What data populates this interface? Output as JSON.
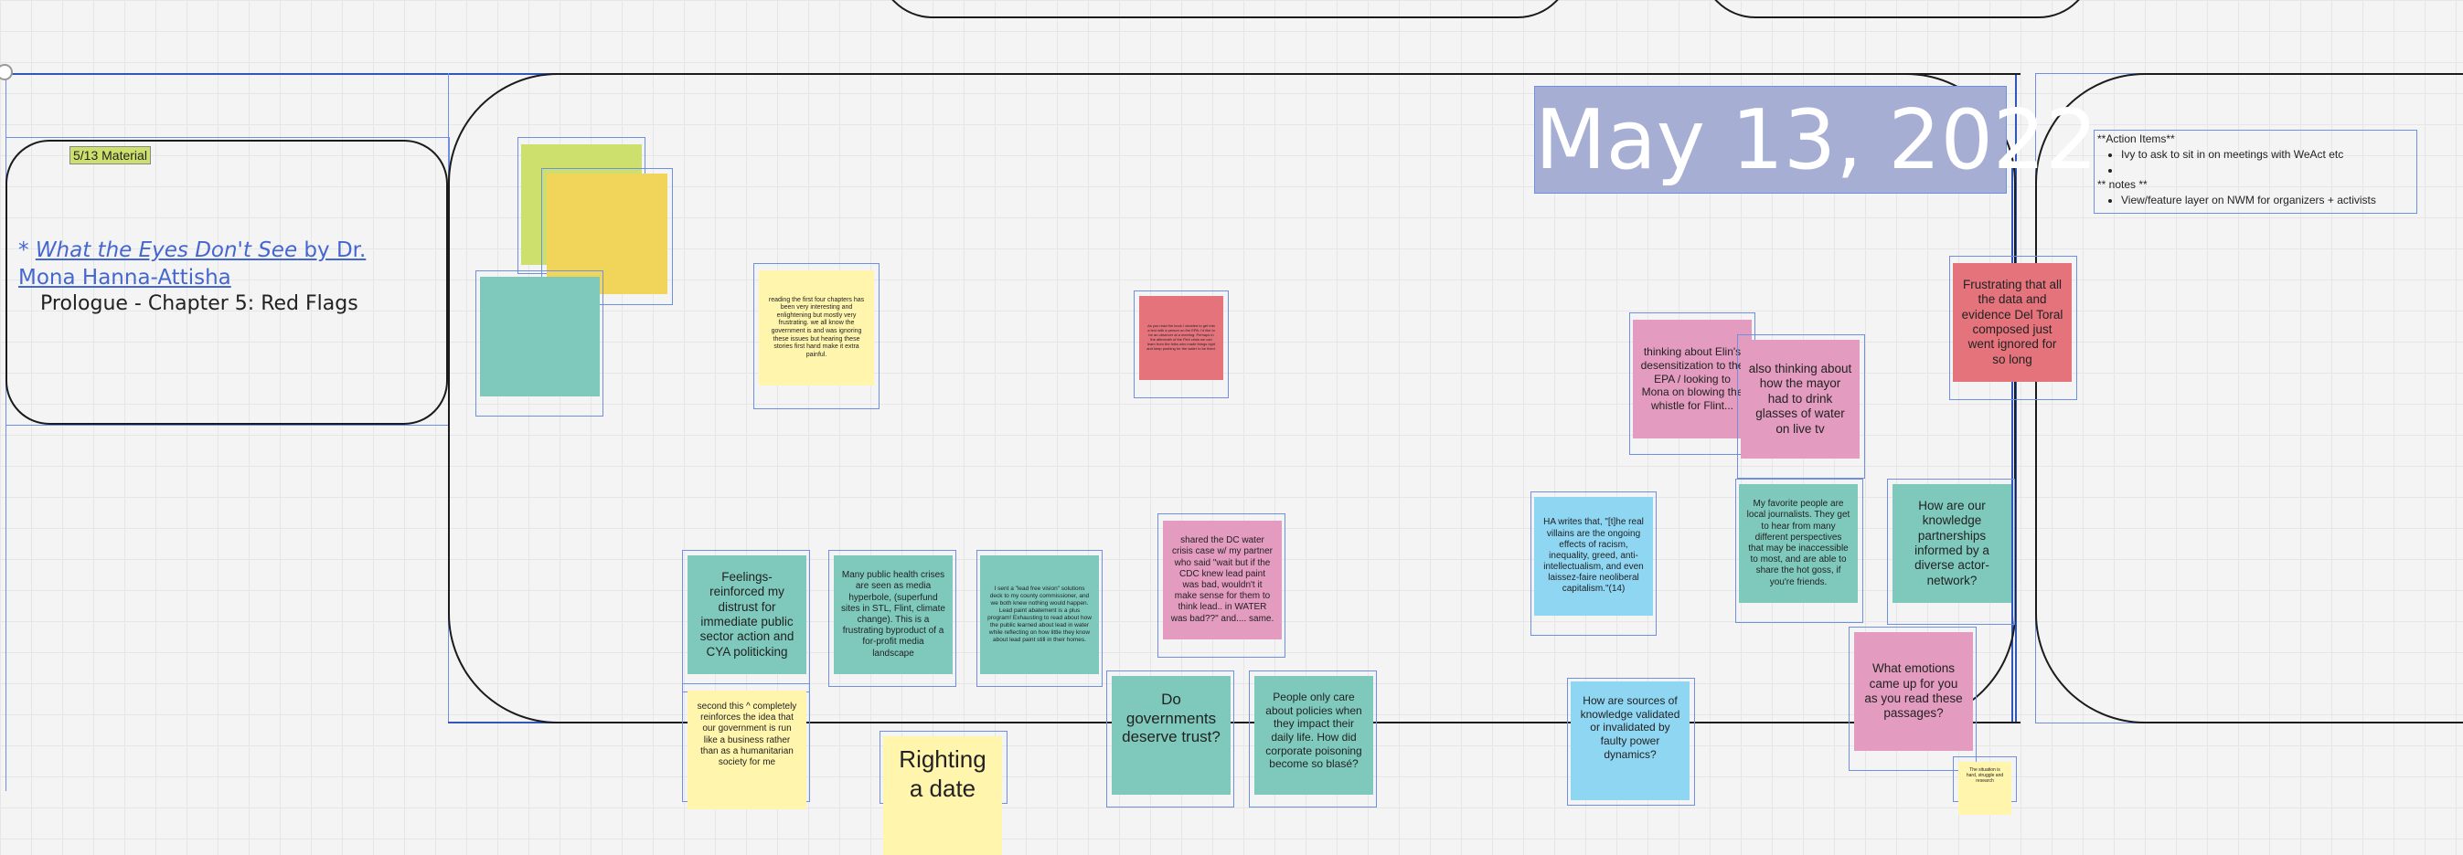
{
  "board": {
    "date_title": "May 13, 2022",
    "material_tag": "5/13 Material",
    "book": {
      "prefix": "* ",
      "title": "What the Eyes Don't See",
      "author": " by Dr. Mona Hanna-Attisha",
      "chapters": "Prologue - Chapter 5: Red Flags"
    },
    "notes": {
      "action_header": "**Action Items**",
      "action_items": [
        "Ivy to ask to sit in on meetings with WeAct etc",
        ""
      ],
      "notes_header": "** notes **",
      "note_items": [
        "View/feature layer on NWM for organizers + activists"
      ]
    }
  },
  "stickies": {
    "reading": "reading the first four chapters has been very interesting and enlightening but mostly very frustrating. we all know the government is and was ignoring these issues but hearing these stories first hand make it extra painful.",
    "red_small": "As you read the book I decided to get into a text with a person on the EPA; I'd like to be an observer at a meeting. Perhaps in the aftermath of the Flint crisis we can learn from the folks who made things right and keep pushing for the water to be fixed.",
    "elin": "thinking about Elin's desensitization to the EPA / looking to Mona on blowing the whistle for Flint...",
    "mayor": "also thinking about how the mayor had to drink glasses of water on live tv",
    "del_toral": "Frustrating that all the data and evidence Del Toral composed just went ignored for so long",
    "feelings": "Feelings-reinforced my distrust for immediate public sector action and CYA politicking",
    "public_health": "Many public health crises are seen as media hyperbole, (superfund sites in STL, Flint, climate change). This is a frustrating byproduct of a for-profit media landscape",
    "lead_free": "I sent a \"lead free vision\" solutions deck to my county commissioner, and we both knew nothing would happen. Lead paint abatement is a plus program! Exhausting to read about how the public learned about lead in water while reflecting on how little they know about lead paint still in their homes.",
    "dc_water": "shared the DC water crisis case w/ my partner who said \"wait but if the CDC knew lead paint was bad, wouldn't it make sense for them to think lead.. in WATER was bad??\" and.... same.",
    "ha_writes": "HA writes that, \"[t]he real villains are the ongoing effects of racism, inequality, greed, anti-intellectualism, and even laissez-faire neoliberal capitalism.\"(14)",
    "journalists": "My favorite people are local journalists. They get to hear from many different perspectives that may be inaccessible to most, and are able to share the hot goss, if you're friends.",
    "partnerships": "How are our knowledge partnerships informed by a diverse actor-network?",
    "emotions": "What emotions came up for you as you read these passages?",
    "second_this": "second this ^ completely reinforces the idea that our government is run like a business rather than as a humanitarian society for me",
    "righting": "Righting a date",
    "do_govs": "Do governments deserve trust?",
    "people_care": "People only care about policies when they impact their daily life. How did corporate poisoning become so blasé?",
    "sources": "How are sources of knowledge validated or invalidated by faulty power dynamics?",
    "tiny_yellow": "The situation is hard, struggle and research"
  }
}
